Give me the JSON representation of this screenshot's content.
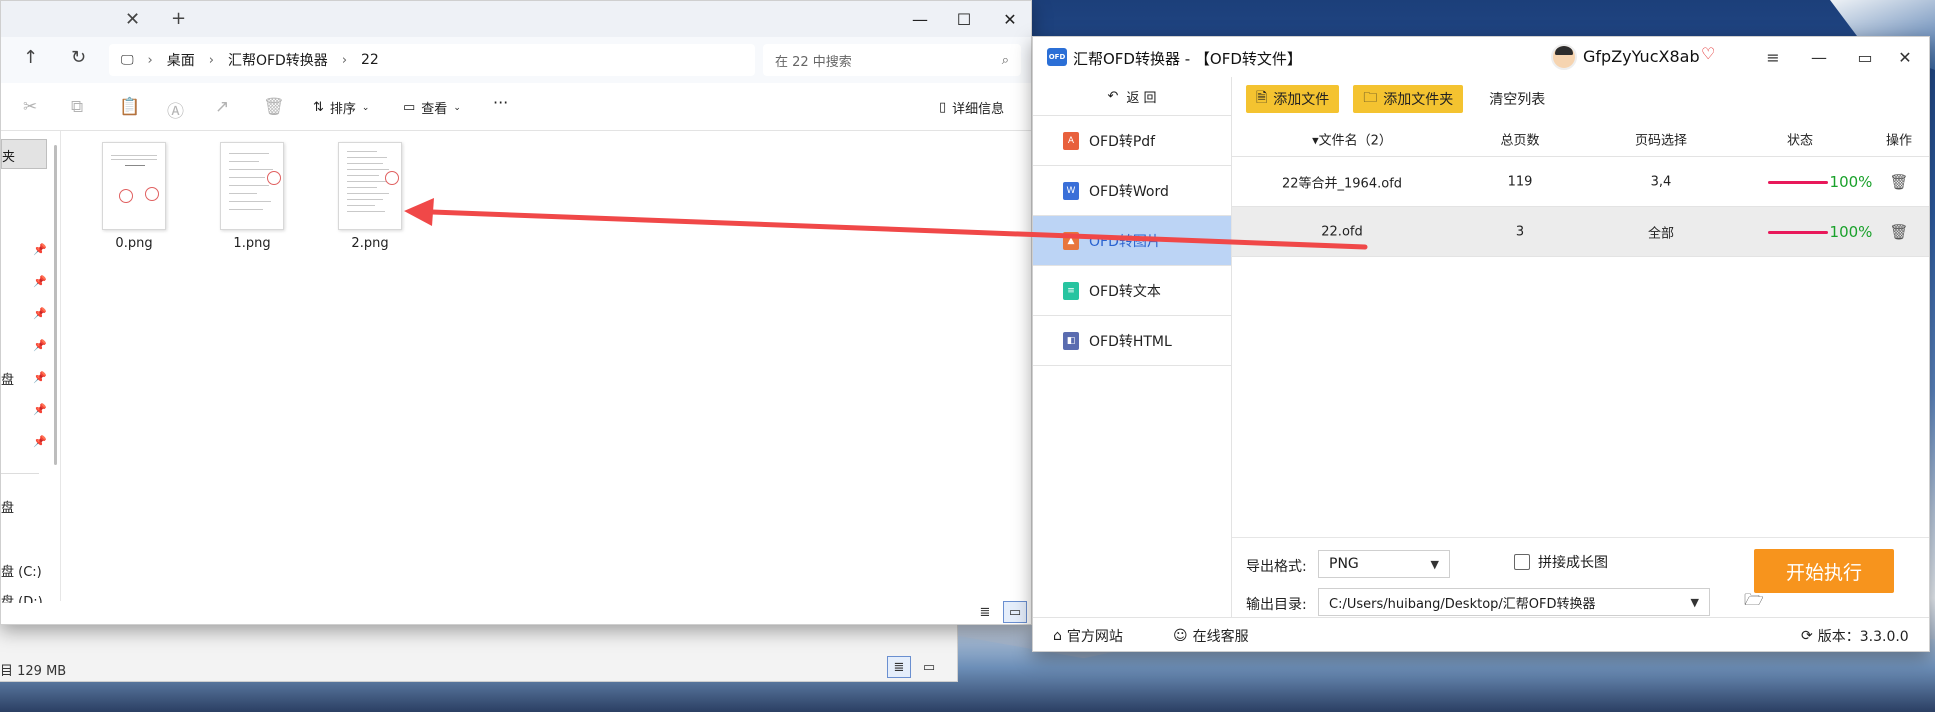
{
  "explorer": {
    "breadcrumb": [
      "桌面",
      "汇帮OFD转换器",
      "22"
    ],
    "search_placeholder": "在 22 中搜索",
    "toolbar": {
      "sort_label": "排序",
      "view_label": "查看",
      "more_label": "···",
      "details_label": "详细信息"
    },
    "sidebar": {
      "selected_label": "夹",
      "items": [
        "盘",
        "盘",
        "盘 (C:)",
        "盘 (D:)"
      ]
    },
    "files": [
      {
        "name": "0.png"
      },
      {
        "name": "1.png"
      },
      {
        "name": "2.png"
      }
    ],
    "status_text": "目  129 MB"
  },
  "converter": {
    "app_title": "汇帮OFD转换器 - 【OFD转文件】",
    "logo_text": "OFD",
    "user_name": "GfpZyYucX8ab",
    "back_label": "返  回",
    "menu": [
      {
        "label": "OFD转Pdf",
        "icon": "pdf-icon",
        "color": "#e8603c"
      },
      {
        "label": "OFD转Word",
        "icon": "word-icon",
        "color": "#3a6fd8"
      },
      {
        "label": "OFD转图片",
        "icon": "image-icon",
        "color": "#e8763c"
      },
      {
        "label": "OFD转文本",
        "icon": "text-icon",
        "color": "#27c4a0"
      },
      {
        "label": "OFD转HTML",
        "icon": "html-icon",
        "color": "#5a6cb0"
      }
    ],
    "buttons": {
      "add_file": "添加文件",
      "add_folder": "添加文件夹",
      "clear_list": "清空列表",
      "start": "开始执行"
    },
    "table": {
      "headers": {
        "name": "▾文件名（2）",
        "pages": "总页数",
        "page_select": "页码选择",
        "status": "状态",
        "action": "操作"
      },
      "rows": [
        {
          "name": "22等合并_1964.ofd",
          "pages": "119",
          "page_select": "3,4",
          "status": "100%",
          "progress": 1.0
        },
        {
          "name": "22.ofd",
          "pages": "3",
          "page_select": "全部",
          "status": "100%",
          "progress": 1.0
        }
      ]
    },
    "options": {
      "format_label": "导出格式:",
      "format_value": "PNG",
      "stitch_label": "拼接成长图",
      "output_label": "输出目录:",
      "output_value": "C:/Users/huibang/Desktop/汇帮OFD转换器"
    },
    "footer": {
      "website": "官方网站",
      "support": "在线客服",
      "version": "版本：3.3.0.0"
    }
  },
  "colors": {
    "accent_yellow": "#f4c330",
    "start_orange": "#f7941d",
    "progress_pink": "#e8185a",
    "pct_green": "#1aa12b",
    "annotation_arrow": "#f04848"
  }
}
